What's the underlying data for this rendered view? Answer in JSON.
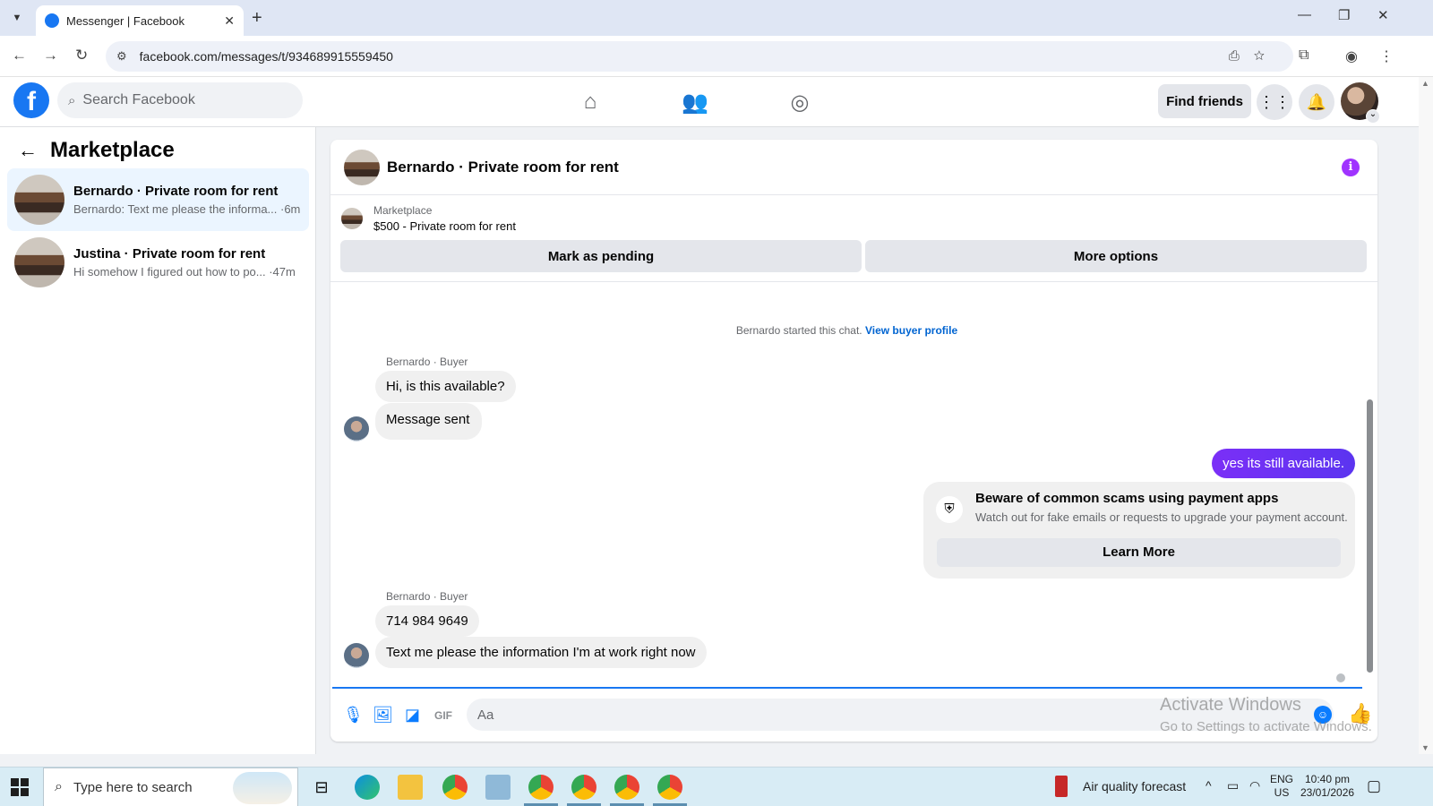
{
  "browser": {
    "tab_title": "Messenger | Facebook",
    "new_tab": "+",
    "url": "facebook.com/messages/t/934689915559450"
  },
  "fb": {
    "logo_letter": "f",
    "search_placeholder": "Search Facebook",
    "find_friends": "Find friends"
  },
  "sidebar": {
    "title": "Marketplace",
    "conversations": [
      {
        "name": "Bernardo · Private room for rent",
        "preview": "Bernardo: Text me please the informa... ·6m",
        "active": true
      },
      {
        "name": "Justina · Private room for rent",
        "preview": "Hi somehow I figured out how to po... ·47m",
        "active": false
      }
    ]
  },
  "chat": {
    "title": "Bernardo · Private room for rent",
    "listing_label": "Marketplace",
    "listing_price": "$500 - Private room for rent",
    "mark_pending": "Mark as pending",
    "more_options": "More options",
    "system_text": "Bernardo started this chat.",
    "system_link": "View buyer profile",
    "sender1": "Bernardo · Buyer",
    "msg1": "Hi, is this available?",
    "msg2": "Message sent",
    "my_msg": "yes its still available.",
    "scam_title": "Beware of common scams using payment apps",
    "scam_desc": "Watch out for fake emails or requests to upgrade your payment account.",
    "learn_more": "Learn More",
    "sender2": "Bernardo · Buyer",
    "msg3": "714 984 9649",
    "msg4": "Text me please the information I'm at work right now",
    "composer_placeholder": "Aa"
  },
  "watermark": {
    "line1": "Activate Windows",
    "line2": "Go to Settings to activate Windows."
  },
  "taskbar": {
    "search_placeholder": "Type here to search",
    "weather": "Air quality forecast",
    "lang1": "ENG",
    "lang2": "US",
    "time": "10:40 pm",
    "date": "23/01/2026"
  },
  "colors": {
    "fb_blue": "#1877f2",
    "my_bubble": "#6a30f4",
    "info_icon": "#a033ff",
    "active_conv": "#ebf5ff"
  },
  "icons": [
    "tab-list-icon",
    "facebook-favicon",
    "close-icon",
    "minimize-icon",
    "maximize-icon",
    "back-icon",
    "forward-icon",
    "reload-icon",
    "site-settings-icon",
    "install-icon",
    "star-icon",
    "extensions-icon",
    "profile-icon",
    "menu-icon",
    "search-icon",
    "home-icon",
    "friends-icon",
    "groups-icon",
    "apps-grid-icon",
    "bell-icon",
    "info-icon",
    "shield-icon",
    "mic-icon",
    "photo-icon",
    "sticker-icon",
    "gif-icon",
    "emoji-icon",
    "thumbs-up-icon",
    "windows-start-icon"
  ]
}
